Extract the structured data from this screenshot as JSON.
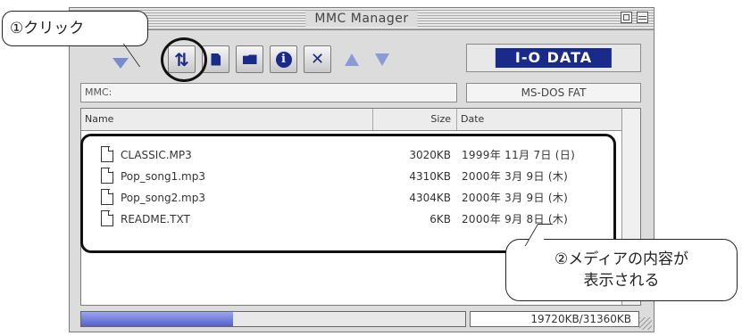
{
  "window": {
    "title": "MMC Manager"
  },
  "callouts": {
    "step1": "①クリック",
    "step2_line1": "②メディアの内容が",
    "step2_line2": "表示される"
  },
  "toolbar": {
    "brand": "I-O DATA",
    "buttons": [
      {
        "icon": "refresh-icon",
        "glyph": "⇅"
      },
      {
        "icon": "document-icon"
      },
      {
        "icon": "folder-icon"
      },
      {
        "icon": "info-icon",
        "glyph": "i"
      },
      {
        "icon": "delete-icon",
        "glyph": "✕"
      },
      {
        "icon": "up-arrow-icon"
      },
      {
        "icon": "down-arrow-icon"
      }
    ]
  },
  "path": {
    "value": "MMC:"
  },
  "filesystem": {
    "value": "MS-DOS FAT"
  },
  "list": {
    "columns": {
      "name": "Name",
      "size": "Size",
      "date": "Date"
    },
    "rows": [
      {
        "name": "CLASSIC.MP3",
        "size": "3020KB",
        "date": "1999年 11月 7日 (日)"
      },
      {
        "name": "Pop_song1.mp3",
        "size": "4310KB",
        "date": "2000年 3月 9日 (木)"
      },
      {
        "name": "Pop_song2.mp3",
        "size": "4304KB",
        "date": "2000年 3月 9日 (木)"
      },
      {
        "name": "README.TXT",
        "size": "6KB",
        "date": "2000年 9月 8日 (木)"
      }
    ]
  },
  "status": {
    "capacity": "19720KB/31360KB",
    "used_fraction": 0.395
  },
  "colors": {
    "brand_bg": "#1a2a8a",
    "progress": "#6b75d6",
    "icon": "#1a2a8a"
  }
}
